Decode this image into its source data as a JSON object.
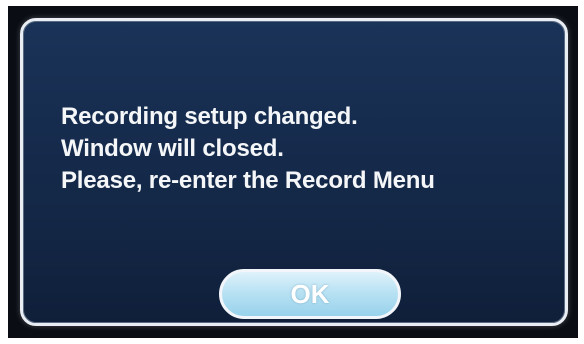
{
  "dialog": {
    "message_lines": [
      "Recording setup changed.",
      "Window will closed.",
      "Please, re-enter the Record Menu"
    ],
    "ok_label": "OK"
  },
  "colors": {
    "dialog_background": "#162c4e",
    "dialog_border": "#e8eef4",
    "text": "#f4f6f8",
    "button_fill": "#b9e2f3",
    "button_border": "#f2f6fa"
  }
}
